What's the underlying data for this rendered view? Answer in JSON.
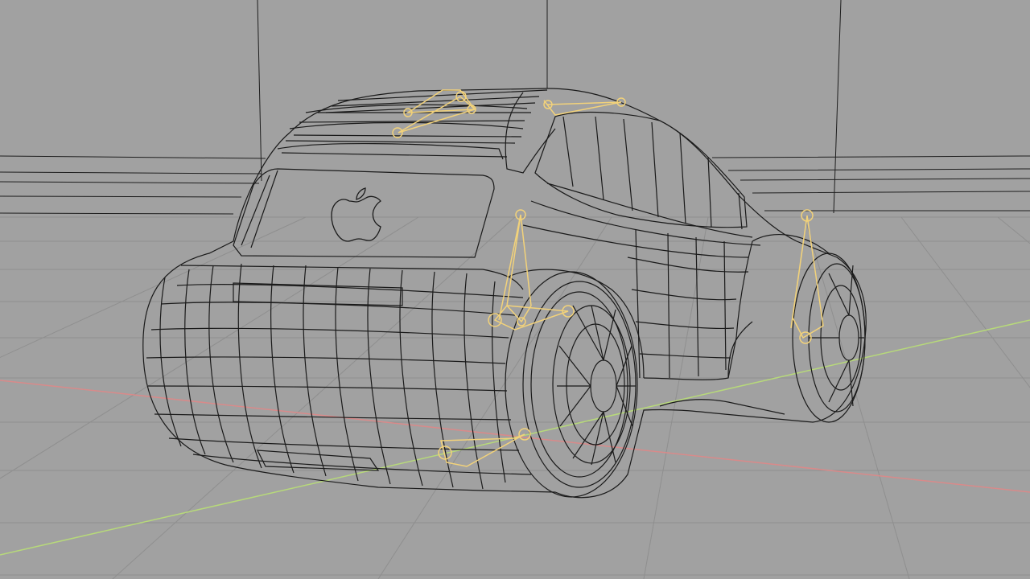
{
  "viewport": {
    "background": "#a1a1a1",
    "wire_color": "#1a1a1a",
    "grid_color": "#8c8c8c",
    "x_axis_color": "#d98a8a",
    "y_axis_color": "#b7d97a",
    "light_gizmo_color": "#f2d27a"
  },
  "scene": {
    "object": "car-wireframe",
    "emblem": "apple-logo-icon",
    "light_gizmos": 6
  }
}
